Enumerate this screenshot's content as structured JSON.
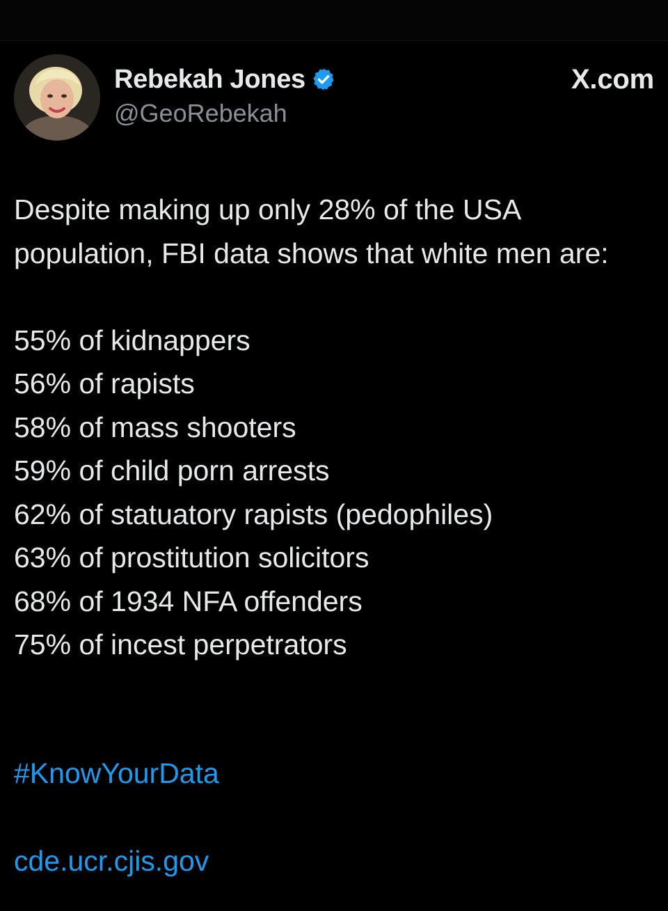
{
  "tweet": {
    "author": {
      "display_name": "Rebekah Jones",
      "handle": "@GeoRebekah",
      "verified": true,
      "avatar_icon": "profile-photo"
    },
    "source_label": "X.com",
    "intro": "Despite making up only 28% of the USA population, FBI data shows that white men are:",
    "stats": [
      "55% of kidnappers",
      "56% of rapists",
      "58% of mass shooters",
      "59% of child porn arrests",
      "62% of statuatory rapists (pedophiles)",
      "63% of prostitution solicitors",
      "68% of 1934 NFA offenders",
      "75% of incest perpetrators"
    ],
    "hashtag": "#KnowYourData",
    "link": "cde.ucr.cjis.gov"
  },
  "colors": {
    "background": "#000000",
    "text": "#e7e9ea",
    "secondary_text": "#8b9096",
    "link": "#1d9bf0",
    "verified_badge": "#1d9bf0"
  }
}
